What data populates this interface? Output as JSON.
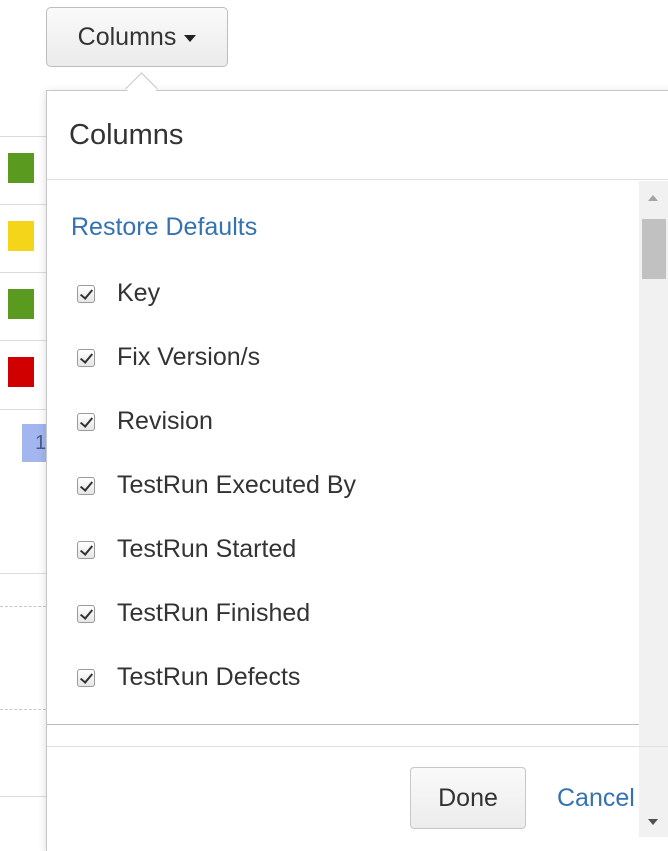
{
  "toolbar": {
    "columns_button_label": "Columns"
  },
  "popover": {
    "title": "Columns",
    "restore_defaults_label": "Restore Defaults",
    "options": [
      {
        "label": "Key",
        "checked": true
      },
      {
        "label": "Fix Version/s",
        "checked": true
      },
      {
        "label": "Revision",
        "checked": true
      },
      {
        "label": "TestRun Executed By",
        "checked": true
      },
      {
        "label": "TestRun Started",
        "checked": true
      },
      {
        "label": "TestRun Finished",
        "checked": true
      },
      {
        "label": "TestRun Defects",
        "checked": true
      }
    ],
    "done_label": "Done",
    "cancel_label": "Cancel"
  },
  "background": {
    "status_colors": [
      "#5a9a1e",
      "#f5d51a",
      "#5a9a1e",
      "#d10000"
    ],
    "chip_text": "1",
    "chip_color": "#a4b6ef"
  },
  "colors": {
    "link": "#3572b0",
    "border": "#c7c7c7"
  }
}
